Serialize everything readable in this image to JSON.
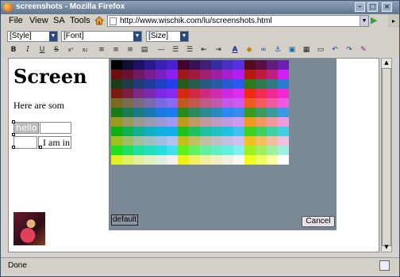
{
  "window": {
    "title": "screenshots - Mozilla Firefox"
  },
  "menubar": {
    "items": [
      "File",
      "View",
      "SA",
      "Tools"
    ]
  },
  "address": {
    "url": "http://www.wischik.com/lu/screenshots.html"
  },
  "toolbar": {
    "style_select": "[Style]",
    "font_select": "[Font]",
    "size_select": "[Size]"
  },
  "editor": {
    "heading": "Screen",
    "paragraph": "Here are som",
    "cell_hello": "hello",
    "cell_text": "I am in"
  },
  "color_dialog": {
    "default_label": "default",
    "cancel_label": "Cancel",
    "rows": [
      [
        "#000000",
        "#0f0f33",
        "#1f0f66",
        "#2b1a8c",
        "#3a1fb3",
        "#4a1fd0",
        "#44002b",
        "#3a1050",
        "#402077",
        "#3b2ba0",
        "#4a30c0",
        "#5530e0",
        "#550a20",
        "#5a1044",
        "#5d1e77",
        "#6a1fb0"
      ],
      [
        "#6b1010",
        "#6b1030",
        "#701a60",
        "#7a1b90",
        "#7c1fc0",
        "#8a1ff0",
        "#9a1a1a",
        "#a01a40",
        "#a01f70",
        "#a01fa0",
        "#a91fd0",
        "#b31ff0",
        "#b31a10",
        "#c01a40",
        "#c01f80",
        "#d01ff0"
      ],
      [
        "#1f3b1a",
        "#1f3b44",
        "#203b77",
        "#203b99",
        "#2040c0",
        "#2040f0",
        "#2a5a1a",
        "#2a5a50",
        "#2a5a80",
        "#2a5aa5",
        "#2a5ad0",
        "#2a5af0",
        "#2e7a1a",
        "#2e7a50",
        "#2e7a80",
        "#2e7ad0"
      ],
      [
        "#7a1a10",
        "#7a1f40",
        "#7a2a80",
        "#7a2ab0",
        "#7a2ae0",
        "#8a2af0",
        "#d02a10",
        "#d02a40",
        "#d02a80",
        "#d02ab0",
        "#d02ae0",
        "#e02af0",
        "#f02a10",
        "#f02a50",
        "#f02a90",
        "#f02ad0"
      ],
      [
        "#7a6a20",
        "#7a6a50",
        "#7a6a80",
        "#7a6ab0",
        "#7a6ae0",
        "#8a6af0",
        "#c05a20",
        "#c05a50",
        "#c05a80",
        "#c05ab0",
        "#c05ae0",
        "#d05af0",
        "#f05a20",
        "#f05a60",
        "#f05aa0",
        "#f05ae0"
      ],
      [
        "#1a7a1a",
        "#1a7a50",
        "#1a7a80",
        "#1a7ab0",
        "#1a7ae0",
        "#1a7af0",
        "#2a8a20",
        "#2a8a60",
        "#2a8a90",
        "#2a8ac0",
        "#2a8af0",
        "#3a8af0",
        "#3a9a20",
        "#3a9a60",
        "#3a9aa0",
        "#3a9ae0"
      ],
      [
        "#9a9a20",
        "#9a9a60",
        "#9a9a90",
        "#9a9ab0",
        "#9a9ad0",
        "#a09af0",
        "#c09a20",
        "#c09a60",
        "#c09aa0",
        "#c09ac0",
        "#c09ae0",
        "#d09af0",
        "#f09a20",
        "#f09a60",
        "#f09aa0",
        "#f09ae0"
      ],
      [
        "#10b010",
        "#10b050",
        "#10b090",
        "#10b0c0",
        "#10b0e0",
        "#10b0f0",
        "#20c020",
        "#20c060",
        "#20c0a0",
        "#20c0c0",
        "#20c0e0",
        "#40c0f0",
        "#40d020",
        "#40d060",
        "#40d0a0",
        "#40d0e0"
      ],
      [
        "#a0c020",
        "#a0c060",
        "#a0c0a0",
        "#a0c0c0",
        "#a0c0e0",
        "#b0c0f0",
        "#c0c020",
        "#c0c060",
        "#c0c0a0",
        "#c0c0c0",
        "#c0c0e0",
        "#d0c0f0",
        "#f0c020",
        "#f0c060",
        "#f0c0a0",
        "#f0c0e0"
      ],
      [
        "#20e020",
        "#20e060",
        "#20e0a0",
        "#20e0c0",
        "#20e0e0",
        "#40e0f0",
        "#60f020",
        "#60f060",
        "#60f0a0",
        "#60f0c0",
        "#60f0e0",
        "#80f0f0",
        "#a0f020",
        "#a0f060",
        "#a0f0a0",
        "#a0f0e0"
      ],
      [
        "#e0f020",
        "#e0f060",
        "#e0f0a0",
        "#e0f0c0",
        "#e0f0e0",
        "#f0f0f0",
        "#f0f020",
        "#f0f060",
        "#f0f0a0",
        "#f0f0c0",
        "#f0f0e0",
        "#f8f8f0",
        "#f0ff20",
        "#f0ff60",
        "#f8ffa0",
        "#ffffff"
      ]
    ]
  },
  "status": {
    "text": "Done"
  }
}
